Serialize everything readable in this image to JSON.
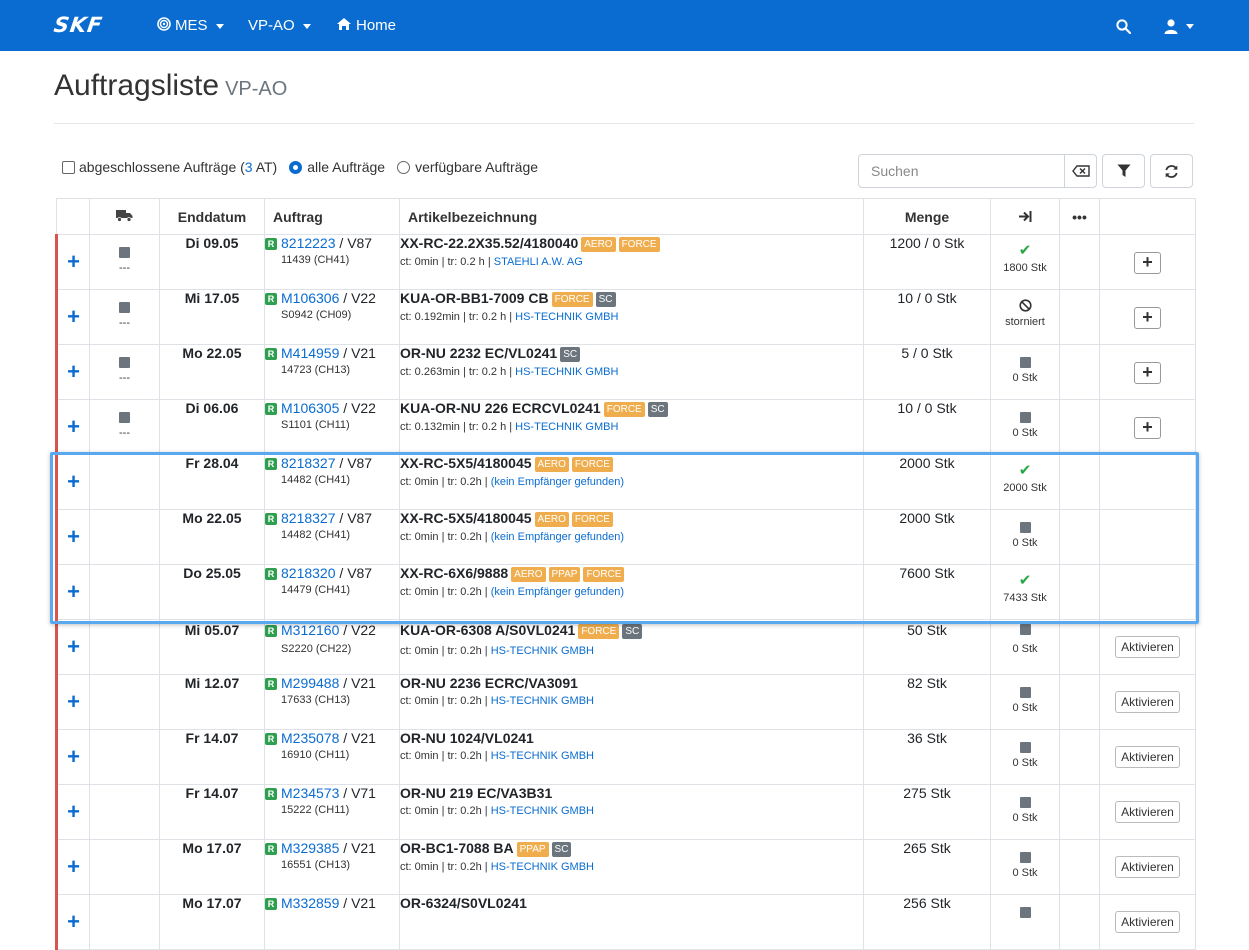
{
  "navbar": {
    "logo": "SKF",
    "mes_label": "MES",
    "vpao_label": "VP-AO",
    "home_label": "Home"
  },
  "header": {
    "title": "Auftragsliste",
    "subtitle": "VP-AO"
  },
  "filters": {
    "closed_orders_prefix": "abgeschlossene Aufträge (",
    "closed_orders_count": "3",
    "closed_orders_suffix": " AT)",
    "all_orders": "alle Aufträge",
    "available_orders": "verfügbare Aufträge"
  },
  "search": {
    "placeholder": "Suchen"
  },
  "table": {
    "headers": {
      "enddatum": "Enddatum",
      "auftrag": "Auftrag",
      "artikel": "Artikelbezeichnung",
      "menge": "Menge",
      "more": "•••"
    },
    "rows": [
      {
        "date": "Di 09.05",
        "order_no": "8212223",
        "order_ver": "V87",
        "order_sub": "11439 (CH41)",
        "art": "XX-RC-22.2X35.52/4180040",
        "ct": "ct: 0min | tr: 0.2 h | ",
        "recipient": "STAEHLI A.W. AG",
        "menge": "1200 / 0 Stk",
        "status_text": "1800 Stk",
        "transport_dash": "---",
        "action": "+"
      },
      {
        "date": "Mi 17.05",
        "order_no": "M106306",
        "order_ver": "V22",
        "order_sub": "S0942 (CH09)",
        "art": "KUA-OR-BB1-7009 CB",
        "ct": "ct: 0.192min | tr: 0.2 h | ",
        "recipient": "HS-TECHNIK GMBH",
        "menge": "10 / 0 Stk",
        "status_text": "storniert",
        "transport_dash": "---",
        "action": "+"
      },
      {
        "date": "Mo 22.05",
        "order_no": "M414959",
        "order_ver": "V21",
        "order_sub": "14723 (CH13)",
        "art": "OR-NU 2232 EC/VL0241",
        "ct": "ct: 0.263min | tr: 0.2 h | ",
        "recipient": "HS-TECHNIK GMBH",
        "menge": "5 / 0 Stk",
        "status_text": "0 Stk",
        "transport_dash": "---",
        "action": "+"
      },
      {
        "date": "Di 06.06",
        "order_no": "M106305",
        "order_ver": "V22",
        "order_sub": "S1101 (CH11)",
        "art": "KUA-OR-NU 226 ECRCVL0241",
        "ct": "ct: 0.132min | tr: 0.2 h | ",
        "recipient": "HS-TECHNIK GMBH",
        "menge": "10 / 0 Stk",
        "status_text": "0 Stk",
        "transport_dash": "---",
        "action": "+"
      },
      {
        "date": "Fr 28.04",
        "order_no": "8218327",
        "order_ver": "V87",
        "order_sub": "14482 (CH41)",
        "art": "XX-RC-5X5/4180045",
        "ct": "ct: 0min | tr: 0.2h | ",
        "recipient": "(kein Empfänger gefunden)",
        "menge": "2000 Stk",
        "status_text": "2000 Stk"
      },
      {
        "date": "Mo 22.05",
        "order_no": "8218327",
        "order_ver": "V87",
        "order_sub": "14482 (CH41)",
        "art": "XX-RC-5X5/4180045",
        "ct": "ct: 0min | tr: 0.2h | ",
        "recipient": "(kein Empfänger gefunden)",
        "menge": "2000 Stk",
        "status_text": "0 Stk"
      },
      {
        "date": "Do 25.05",
        "order_no": "8218320",
        "order_ver": "V87",
        "order_sub": "14479 (CH41)",
        "art": "XX-RC-6X6/9888",
        "ct": "ct: 0min | tr: 0.2h | ",
        "recipient": "(kein Empfänger gefunden)",
        "menge": "7600 Stk",
        "status_text": "7433 Stk"
      },
      {
        "date": "Mi 05.07",
        "order_no": "M312160",
        "order_ver": "V22",
        "order_sub": "S2220 (CH22)",
        "art": "KUA-OR-6308 A/S0VL0241",
        "ct": "ct: 0min | tr: 0.2h | ",
        "recipient": "HS-TECHNIK GMBH",
        "menge": "50 Stk",
        "status_text": "0 Stk",
        "action": "Aktivieren"
      },
      {
        "date": "Mi 12.07",
        "order_no": "M299488",
        "order_ver": "V21",
        "order_sub": "17633 (CH13)",
        "art": "OR-NU 2236 ECRC/VA3091",
        "ct": "ct: 0min | tr: 0.2h | ",
        "recipient": "HS-TECHNIK GMBH",
        "menge": "82 Stk",
        "status_text": "0 Stk",
        "action": "Aktivieren"
      },
      {
        "date": "Fr 14.07",
        "order_no": "M235078",
        "order_ver": "V21",
        "order_sub": "16910 (CH11)",
        "art": "OR-NU 1024/VL0241",
        "ct": "ct: 0min | tr: 0.2h | ",
        "recipient": "HS-TECHNIK GMBH",
        "menge": "36 Stk",
        "status_text": "0 Stk",
        "action": "Aktivieren"
      },
      {
        "date": "Fr 14.07",
        "order_no": "M234573",
        "order_ver": "V71",
        "order_sub": "15222 (CH11)",
        "art": "OR-NU 219 EC/VA3B31",
        "ct": "ct: 0min | tr: 0.2h | ",
        "recipient": "HS-TECHNIK GMBH",
        "menge": "275 Stk",
        "status_text": "0 Stk",
        "action": "Aktivieren"
      },
      {
        "date": "Mo 17.07",
        "order_no": "M329385",
        "order_ver": "V21",
        "order_sub": "16551 (CH13)",
        "art": "OR-BC1-7088 BA",
        "ct": "ct: 0min | tr: 0.2h | ",
        "recipient": "HS-TECHNIK GMBH",
        "menge": "265 Stk",
        "status_text": "0 Stk",
        "action": "Aktivieren"
      },
      {
        "date": "Mo 17.07",
        "order_no": "M332859",
        "order_ver": "V21",
        "order_sub": "",
        "art": "OR-6324/S0VL0241",
        "ct": "",
        "recipient": "",
        "menge": "256 Stk",
        "status_text": "",
        "action": "Aktivieren"
      }
    ],
    "plus_symbol": "+",
    "order_prefix_badge": "R",
    "version_sep": " / ",
    "tags": {
      "aero": "AERO",
      "force": "FORCE",
      "sc": "SC",
      "ppap": "PPAP"
    }
  },
  "colors": {
    "navbar": "#0a6cd1",
    "accent_blue": "#0a6cd1",
    "tag_orange": "#f0ad4e",
    "tag_grey": "#6c757d",
    "row_marker_red": "#d9534f",
    "check_green": "#28a745",
    "highlight_border": "#5aa9f0"
  }
}
